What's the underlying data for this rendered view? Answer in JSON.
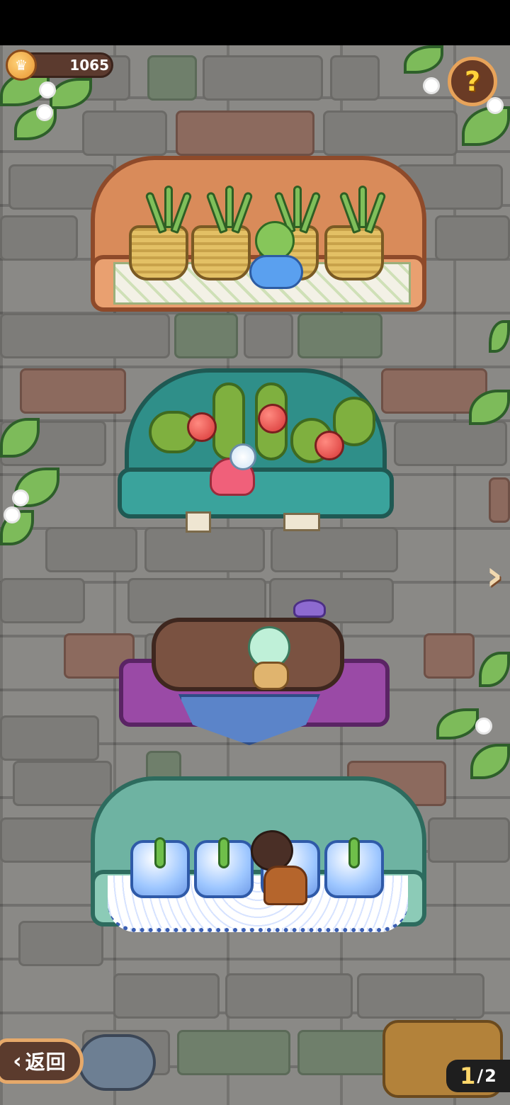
{
  "hud": {
    "coins": "1065",
    "help_symbol": "?"
  },
  "navigation": {
    "next_symbol": "›",
    "back_label": "返回",
    "back_chevron": "‹",
    "page_current": "1",
    "page_separator": "/",
    "page_total": "2"
  },
  "shelves": [
    {
      "name": "grass-pot-shelf",
      "items": 4
    },
    {
      "name": "tomato-vine-shelf",
      "items": 3
    },
    {
      "name": "log-bed-shelf",
      "items": 1
    },
    {
      "name": "sprout-jar-shelf",
      "items": 4
    }
  ],
  "colors": {
    "wall": "#8a8986",
    "accent": "#e6a96a",
    "page_highlight": "#ffd76a"
  }
}
